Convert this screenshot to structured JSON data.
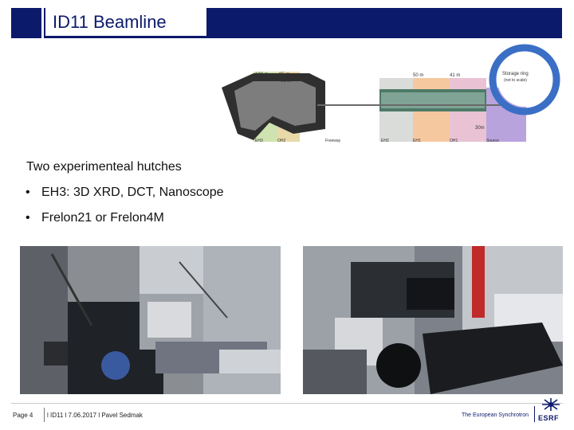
{
  "header": {
    "title": "ID11 Beamline"
  },
  "beamline": {
    "storage_ring_label": "Storage ring",
    "storage_ring_sub": "(not to scale)",
    "distances": [
      "100 m",
      "95 m",
      "91 m",
      "50 m",
      "41 m",
      "30m"
    ],
    "sections": [
      "EH3",
      "OH2",
      "Freeway",
      "EH2",
      "EH1",
      "OH1",
      "Source"
    ]
  },
  "content": {
    "lead": "Two experimenteal hutches",
    "bullet_symbol": "•",
    "bullets": [
      "EH3: 3D XRD, DCT, Nanoscope",
      "Frelon21 or Frelon4M"
    ]
  },
  "footer": {
    "page": "Page 4",
    "text": "l ID11 l 7.06.2017 l Pavel Sedmak",
    "brand": "The European Synchrotron",
    "logo": "ESRF"
  },
  "colors": {
    "accent": "#0c1a6b"
  }
}
